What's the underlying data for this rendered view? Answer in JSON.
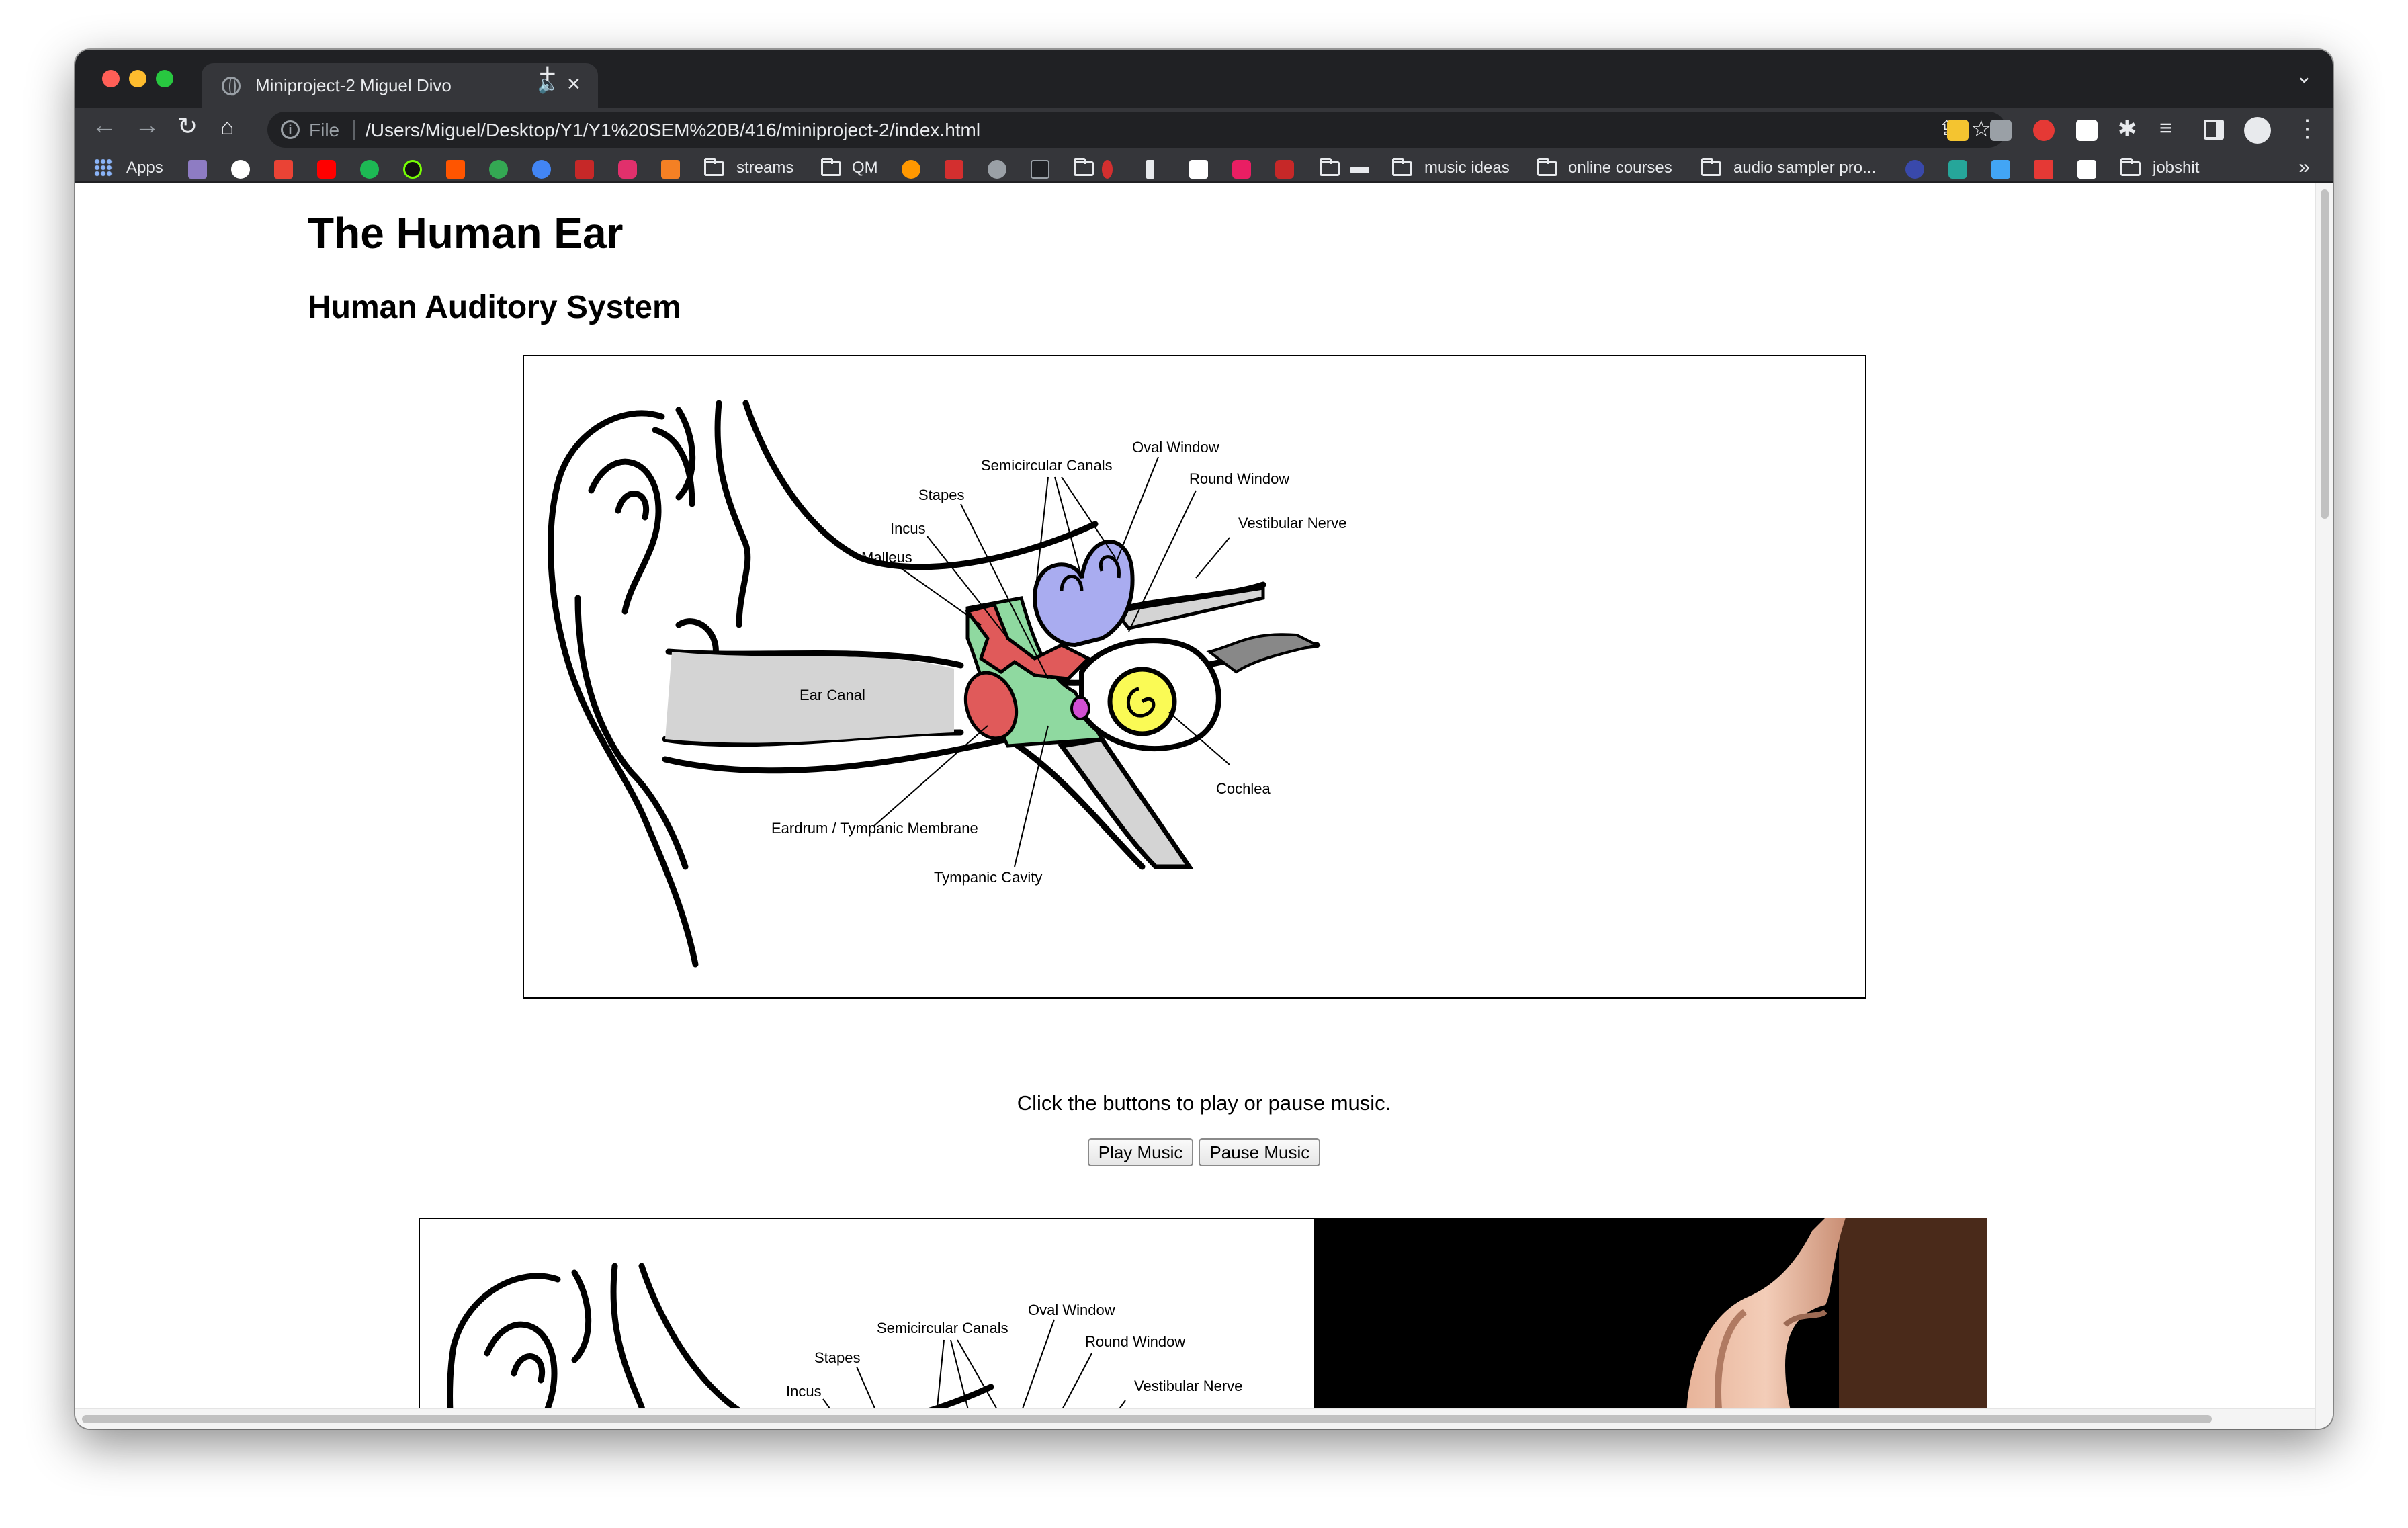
{
  "browser": {
    "tab_title": "Miniproject-2 Miguel Divo",
    "tab_audio_icon": "speaker-icon",
    "tab_close": "×",
    "new_tab": "+",
    "tab_search": "⌄",
    "url_scheme": "File",
    "url": "/Users/Miguel/Desktop/Y1/Y1%20SEM%20B/416/miniproject-2/index.html"
  },
  "bookmarks": {
    "apps": "Apps",
    "streams": "streams",
    "qm": "QM",
    "music_ideas": "music ideas",
    "online_courses": "online courses",
    "audio_sampler": "audio sampler pro...",
    "jobshit": "jobshit",
    "more": "»"
  },
  "page": {
    "title": "The Human Ear",
    "subtitle": "Human Auditory System",
    "instruction": "Click the buttons to play or pause music.",
    "play_label": "Play Music",
    "pause_label": "Pause Music"
  },
  "diagram": {
    "oval_window": "Oval Window",
    "semicircular_canals": "Semicircular Canals",
    "round_window": "Round Window",
    "stapes": "Stapes",
    "vestibular_nerve": "Vestibular Nerve",
    "incus": "Incus",
    "malleus": "Malleus",
    "ear_canal": "Ear Canal",
    "cochlea": "Cochlea",
    "eardrum": "Eardrum / Tympanic Membrane",
    "tympanic_cavity": "Tympanic Cavity"
  },
  "colors": {
    "ear_canal_fill": "#d4d4d4",
    "bones_fill": "#e05a5a",
    "cavity_fill": "#8fd9a0",
    "canals_fill": "#a9acf0",
    "cochlea_fill": "#fafa55",
    "round_window_fill": "#d24fd2"
  }
}
